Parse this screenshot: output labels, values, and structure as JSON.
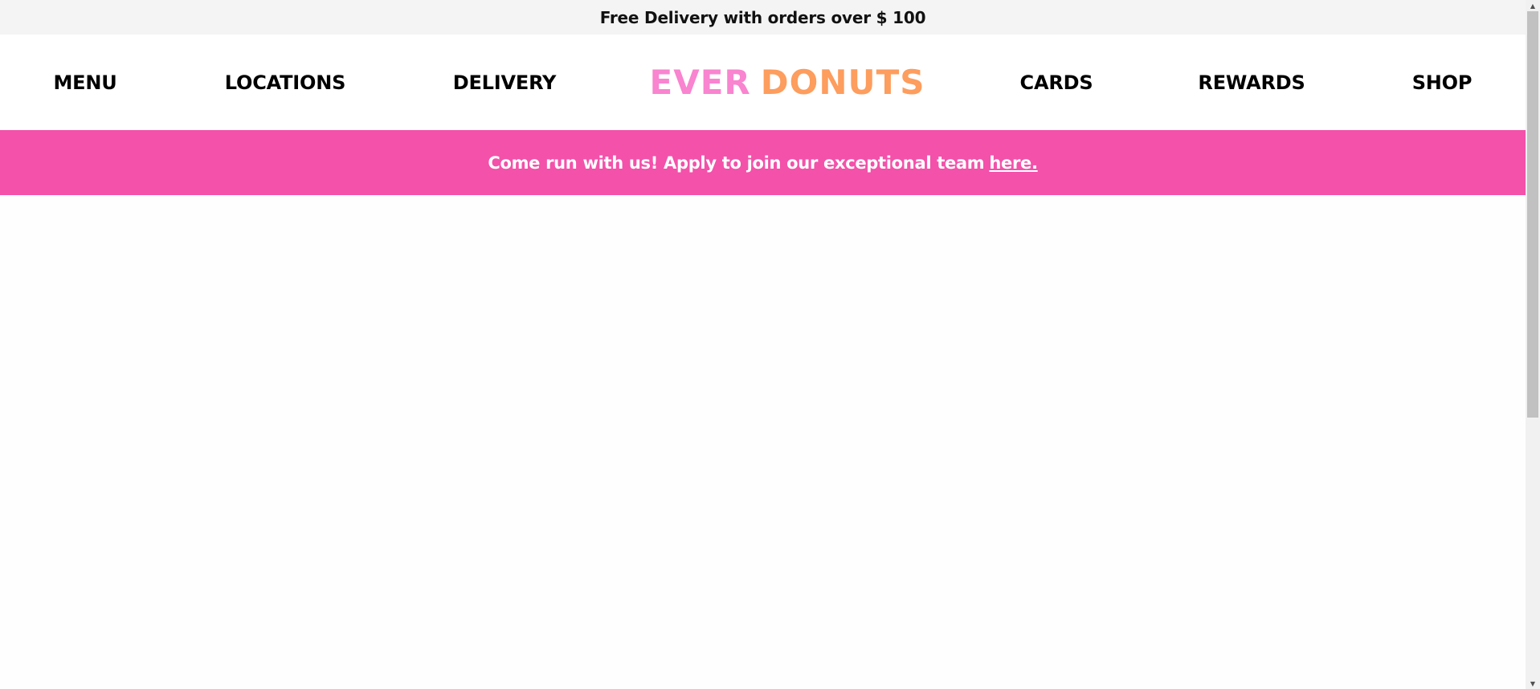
{
  "promo": {
    "text": "Free Delivery with orders over $ 100"
  },
  "nav": {
    "menu": "MENU",
    "locations": "LOCATIONS",
    "delivery": "DELIVERY",
    "logo_part1": "EVER",
    "logo_part2": "DONUTS",
    "cards": "CARDS",
    "rewards": "REWARDS",
    "shop": "SHOP"
  },
  "banner": {
    "text": "Come run with us! Apply to join our exceptional team",
    "link": "here."
  },
  "colors": {
    "promo_bg": "#f4f4f4",
    "banner_bg": "#f351aa",
    "logo_pink": "#f984cf",
    "logo_orange": "#fd9d5e"
  },
  "scrollbar": {
    "up_icon": "triangle-up",
    "down_icon": "triangle-down"
  }
}
